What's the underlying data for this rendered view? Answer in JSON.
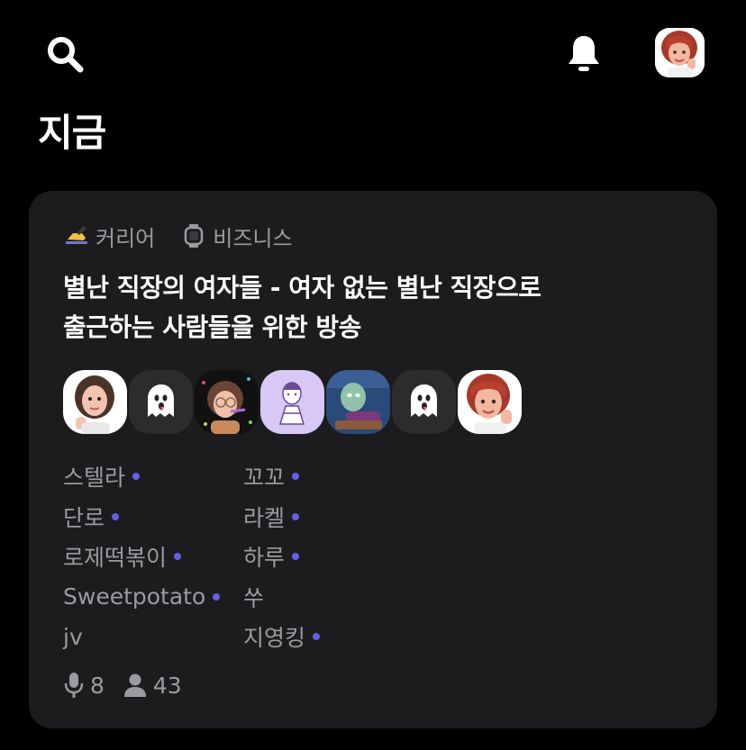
{
  "header": {
    "search_icon": "search-icon",
    "bell_icon": "bell-icon"
  },
  "page": {
    "title": "지금"
  },
  "room": {
    "tags": [
      {
        "emoji": "✍️",
        "label": "커리어"
      },
      {
        "emoji": "⌚",
        "label": "비즈니스"
      }
    ],
    "title_line1": "별난 직장의 여자들 - 여자 없는 별난 직장으로",
    "title_line2": "출근하는 사람들을 위한 방송",
    "speakers_left": [
      {
        "name": "스텔라",
        "dot": true
      },
      {
        "name": "단로",
        "dot": true
      },
      {
        "name": "로제떡볶이",
        "dot": true
      },
      {
        "name": "Sweetpotato",
        "dot": true
      },
      {
        "name": "jv",
        "dot": false
      }
    ],
    "speakers_right": [
      {
        "name": "꼬꼬",
        "dot": true
      },
      {
        "name": "라켈",
        "dot": true
      },
      {
        "name": "하루",
        "dot": true
      },
      {
        "name": "쑤",
        "dot": false
      },
      {
        "name": "지영킹",
        "dot": true
      }
    ],
    "speaker_count": "8",
    "listener_count": "43"
  },
  "colors": {
    "background": "#000000",
    "card": "#1c1c1e",
    "muted_text": "#9a9aa0",
    "speaking_dot": "#6b5ce7"
  }
}
